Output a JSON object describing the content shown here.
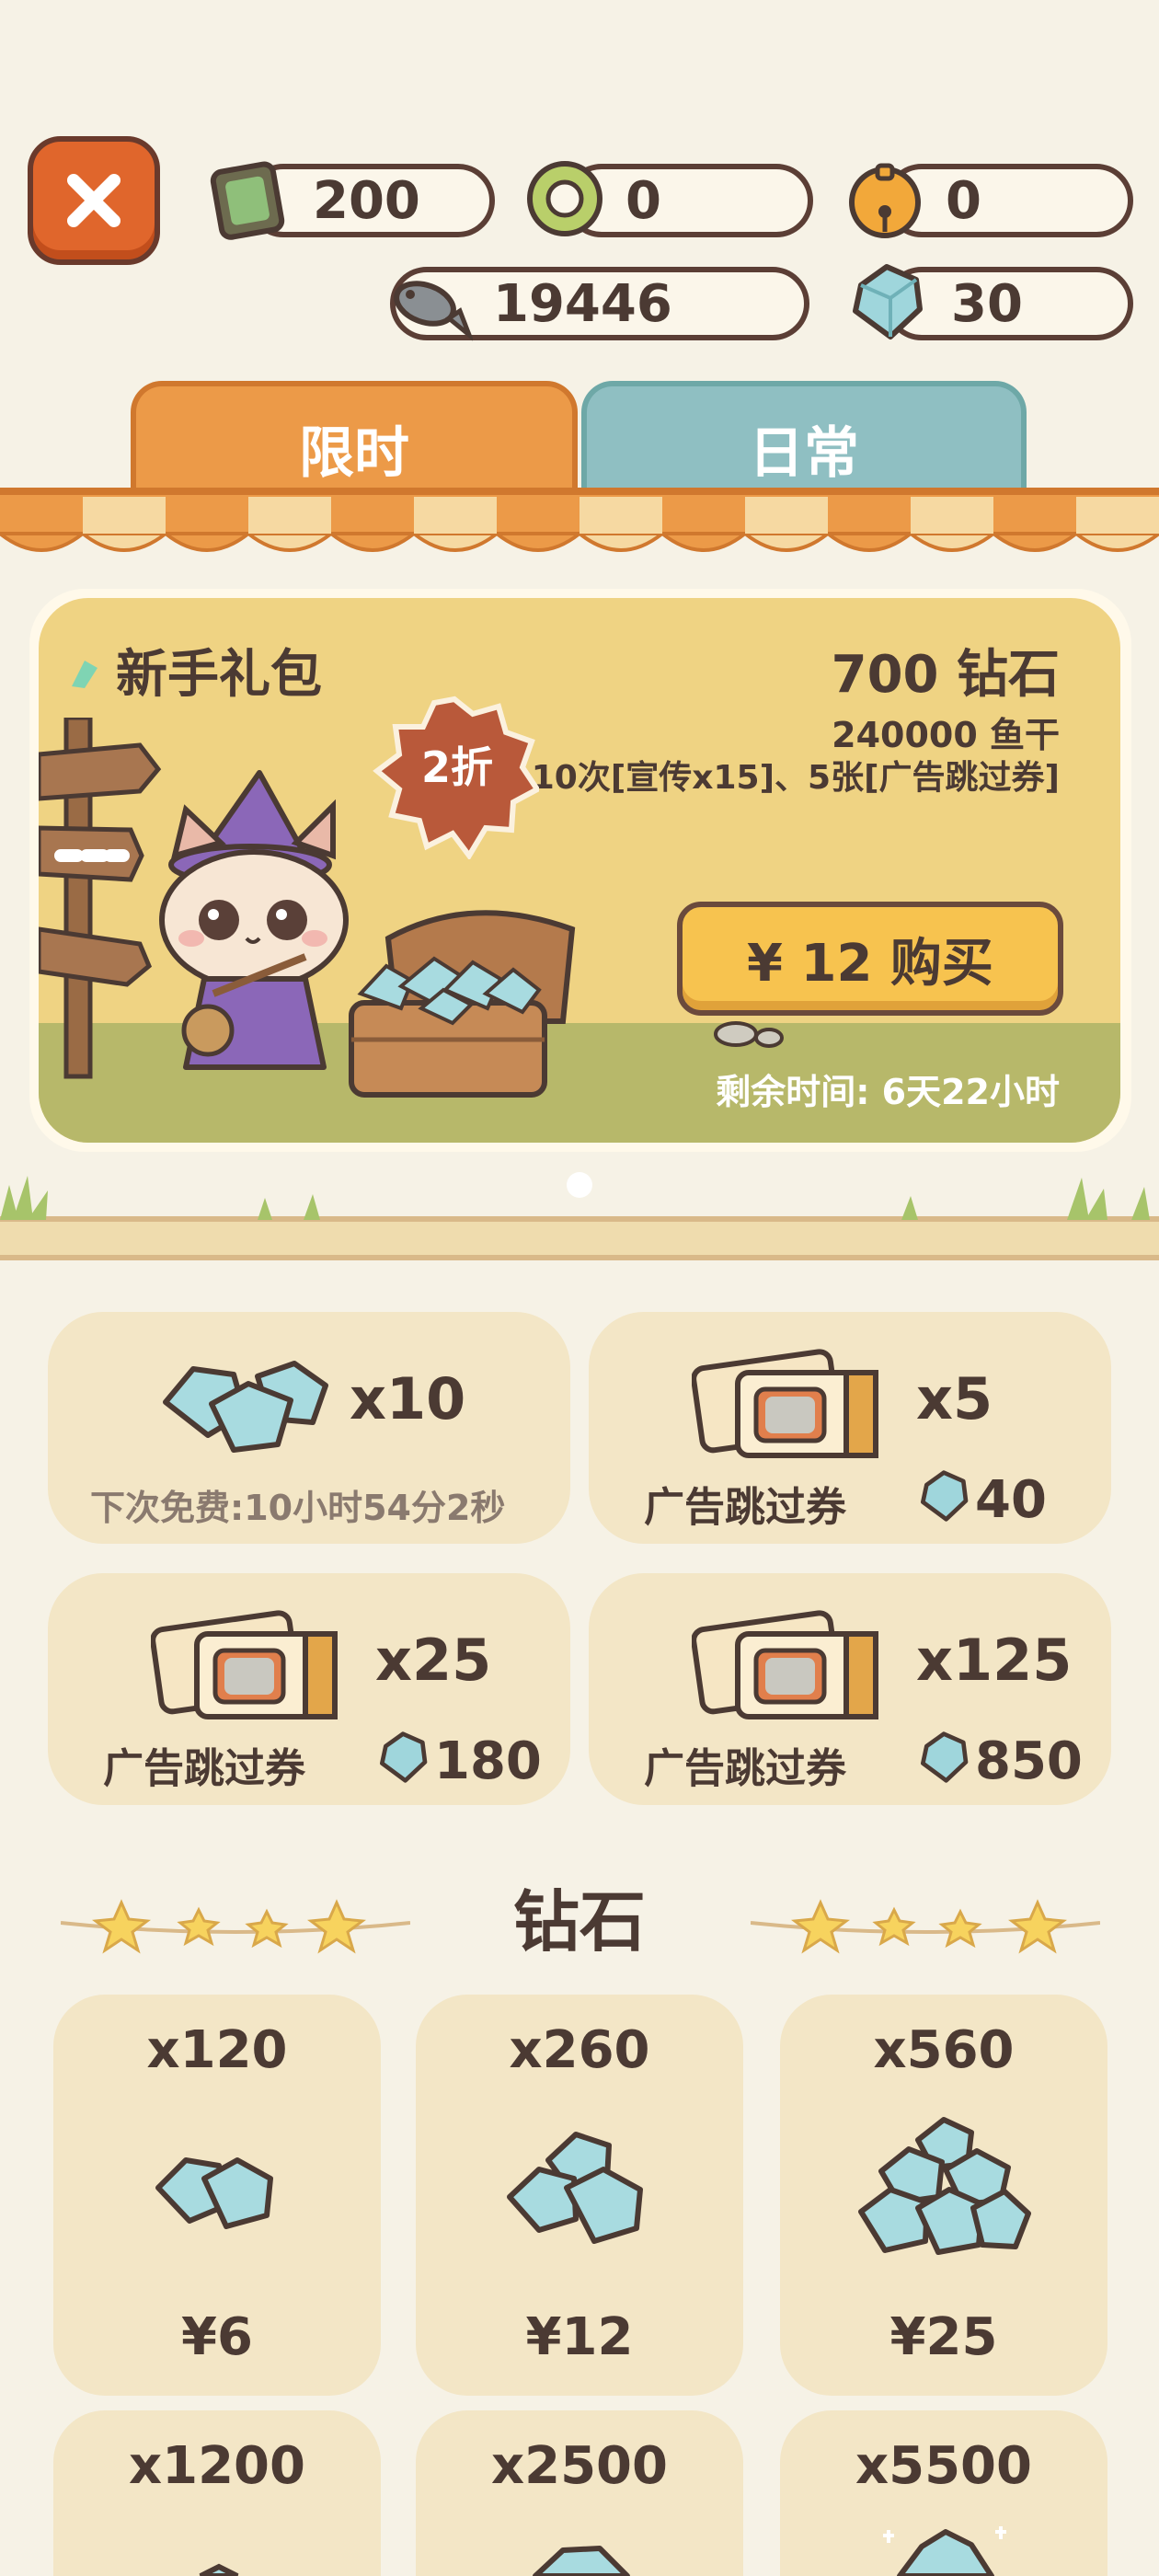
{
  "currencies": {
    "tickets": "200",
    "rings": "0",
    "bells": "0",
    "fish": "19446",
    "diamonds": "30"
  },
  "tabs": [
    {
      "label": "限时",
      "active": true
    },
    {
      "label": "日常",
      "active": false
    }
  ],
  "banner": {
    "title": "新手礼包",
    "diamonds": "700 钻石",
    "fish": "240000 鱼干",
    "extras": "10次[宣传x15]、5张[广告跳过券]",
    "discount": "2折",
    "buy_label": "¥ 12 购买",
    "timer": "剩余时间: 6天22小时"
  },
  "offers": [
    {
      "qty": "x10",
      "free_text": "下次免费:10小时54分2秒"
    },
    {
      "qty": "x5",
      "label": "广告跳过券",
      "price": "40"
    },
    {
      "qty": "x25",
      "label": "广告跳过券",
      "price": "180"
    },
    {
      "qty": "x125",
      "label": "广告跳过券",
      "price": "850"
    }
  ],
  "diamond_section": {
    "title": "钻石",
    "packs": [
      {
        "qty": "x120",
        "price": "¥6"
      },
      {
        "qty": "x260",
        "price": "¥12"
      },
      {
        "qty": "x560",
        "price": "¥25"
      },
      {
        "qty": "x1200",
        "price": ""
      },
      {
        "qty": "x2500",
        "price": ""
      },
      {
        "qty": "x5500",
        "price": ""
      }
    ]
  },
  "colors": {
    "background": "#f6f2e6",
    "tab_limited": "#ec9a48",
    "tab_daily": "#8fbfc2",
    "banner": "#efd383",
    "buy_button": "#f7c34f",
    "close_button": "#e0662c",
    "card": "#f3e6c6",
    "diamond": "#a8dbe0"
  }
}
